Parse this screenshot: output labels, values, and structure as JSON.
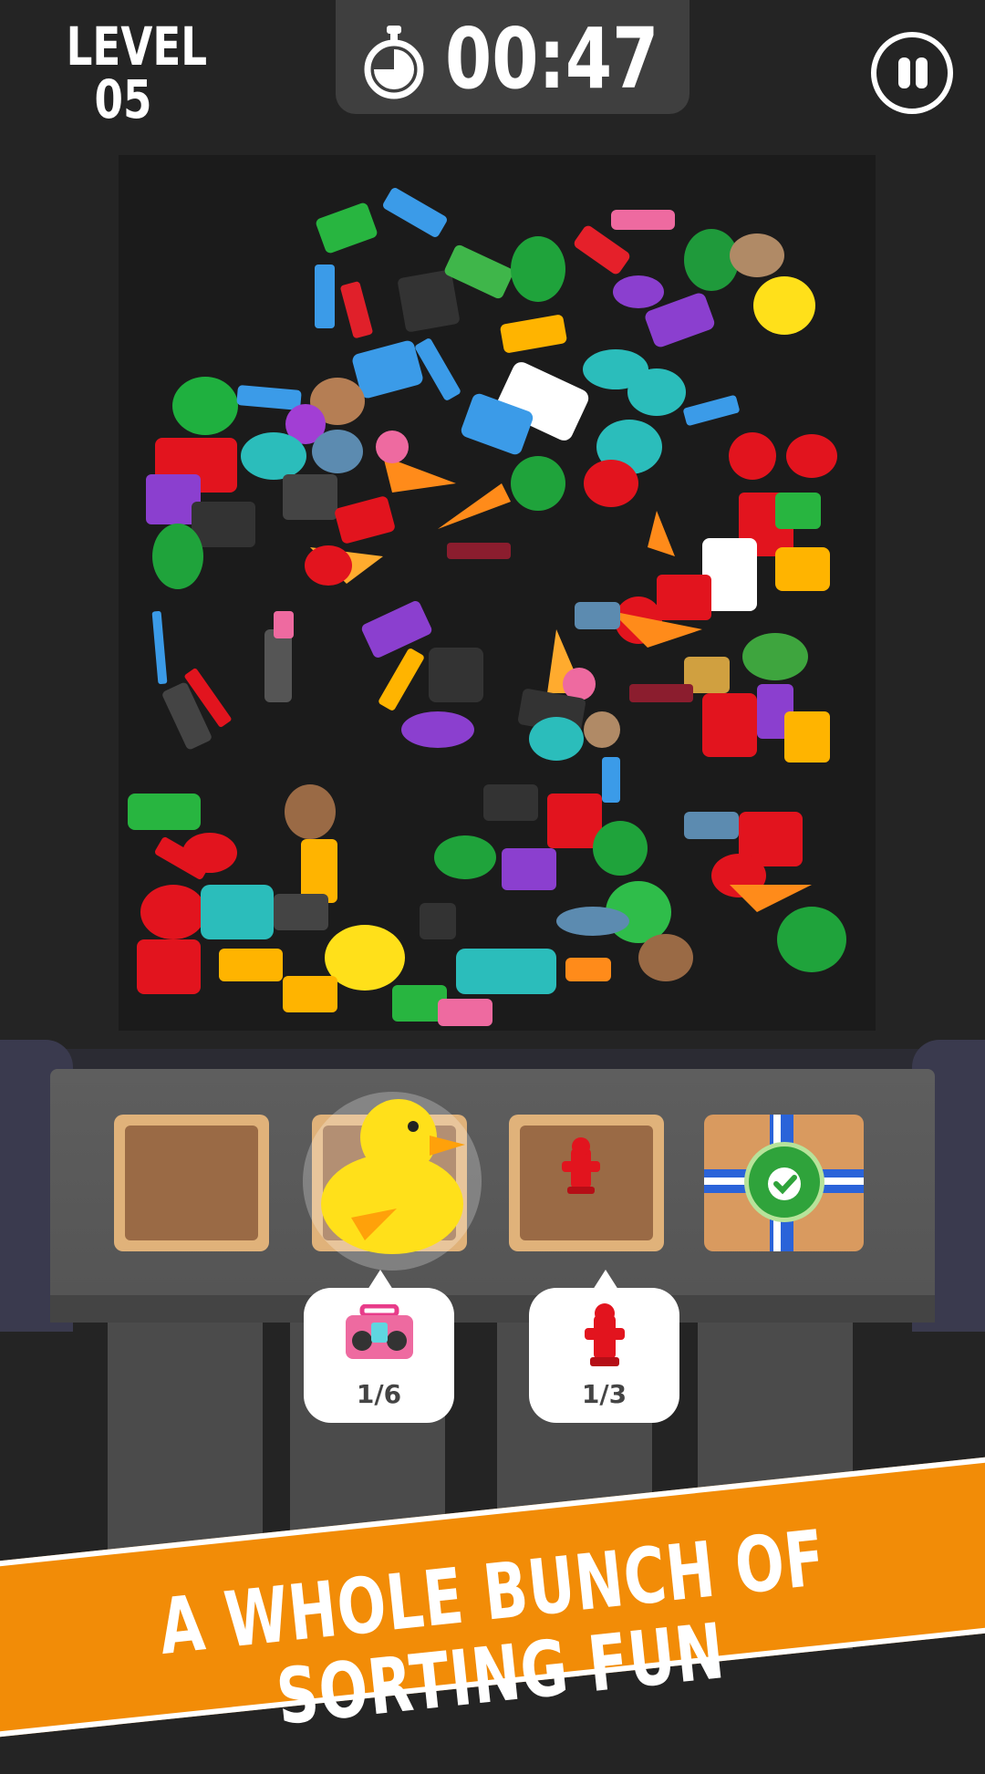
{
  "header": {
    "level_label": "LEVEL",
    "level_number": "05",
    "timer": "00:47"
  },
  "icons": {
    "timer": "stopwatch-icon",
    "pause": "pause-icon"
  },
  "tray": {
    "slots": [
      "empty-box",
      "rubber-duck",
      "fire-hydrant",
      "certified-sealed-box"
    ],
    "seal_text": "CERTIFIED"
  },
  "goals": [
    {
      "item": "boombox",
      "count": "1/6"
    },
    {
      "item": "fire-hydrant",
      "count": "1/3"
    }
  ],
  "banner": {
    "text": "A WHOLE BUNCH OF SORTING FUN"
  },
  "colors": {
    "banner": "#f28c07",
    "background": "#242424",
    "box": "#e0b27a"
  }
}
